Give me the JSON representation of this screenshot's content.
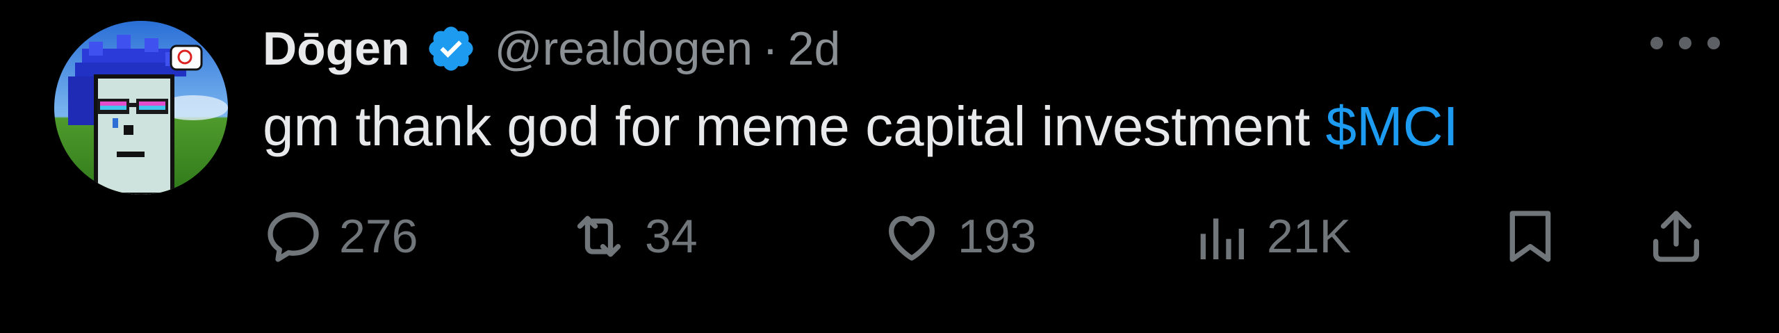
{
  "author": {
    "name": "Dōgen",
    "handle": "@realdogen",
    "separator": "·",
    "time": "2d",
    "verified": true
  },
  "post": {
    "text": "gm thank god for meme capital investment",
    "cashtag": "$MCI"
  },
  "actions": {
    "replies": "276",
    "reposts": "34",
    "likes": "193",
    "views": "21K"
  },
  "colors": {
    "background": "#000000",
    "text": "#e7e9ea",
    "muted": "#71767b",
    "accent": "#1d9bf0"
  },
  "icons": [
    "verified-badge-icon",
    "more-icon",
    "reply-icon",
    "repost-icon",
    "like-icon",
    "views-icon",
    "bookmark-icon",
    "share-icon"
  ]
}
